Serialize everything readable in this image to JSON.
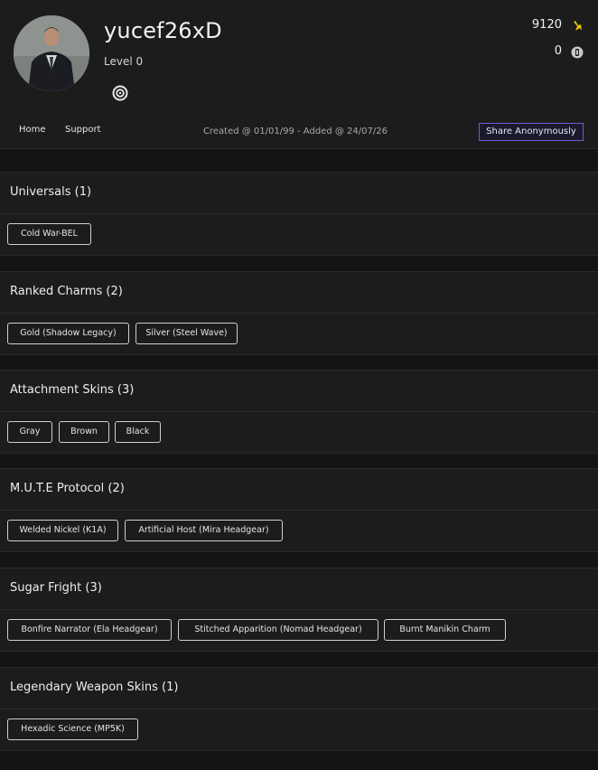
{
  "profile": {
    "username": "yucef26xD",
    "level": "Level 0",
    "stat_1": "9120",
    "stat_2": "0"
  },
  "nav": {
    "home": "Home",
    "support": "Support",
    "created": "Created @ 01/01/99 - Added @ 24/07/26",
    "share": "Share Anonymously"
  },
  "icons": {
    "platform": "ubisoft-icon",
    "stat_1": "renown-icon",
    "stat_2": "r6-credits-icon"
  },
  "colors": {
    "accent": "#6a5dd8",
    "renown": "#e8c400"
  },
  "sections": [
    {
      "title": "Universals (1)",
      "items": [
        "Cold War-BEL"
      ]
    },
    {
      "title": "Ranked Charms (2)",
      "items": [
        "Gold (Shadow Legacy)",
        "Silver (Steel Wave)"
      ]
    },
    {
      "title": "Attachment Skins (3)",
      "items": [
        "Gray",
        "Brown",
        "Black"
      ]
    },
    {
      "title": "M.U.T.E Protocol (2)",
      "items": [
        "Welded Nickel (K1A)",
        "Artificial Host (Mira Headgear)"
      ]
    },
    {
      "title": "Sugar Fright (3)",
      "items": [
        "Bonfire Narrator (Ela Headgear)",
        "Stitched Apparition (Nomad Headgear)",
        "Burnt Manikin Charm"
      ]
    },
    {
      "title": "Legendary Weapon Skins (1)",
      "items": [
        "Hexadic Science (MP5K)"
      ]
    }
  ]
}
